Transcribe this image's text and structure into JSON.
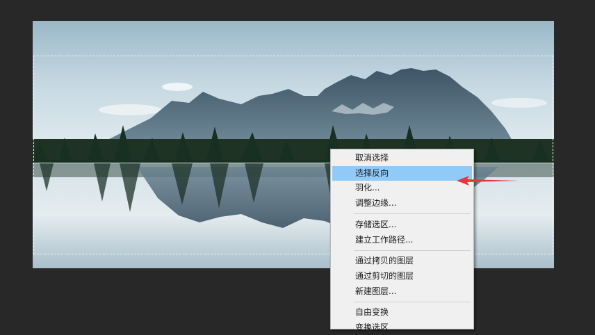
{
  "context_menu": {
    "groups": [
      [
        {
          "label": "取消选择",
          "highlighted": false
        },
        {
          "label": "选择反向",
          "highlighted": true
        },
        {
          "label": "羽化...",
          "highlighted": false
        },
        {
          "label": "调整边缘...",
          "highlighted": false
        }
      ],
      [
        {
          "label": "存储选区...",
          "highlighted": false
        },
        {
          "label": "建立工作路径...",
          "highlighted": false
        }
      ],
      [
        {
          "label": "通过拷贝的图层",
          "highlighted": false
        },
        {
          "label": "通过剪切的图层",
          "highlighted": false
        },
        {
          "label": "新建图层...",
          "highlighted": false
        }
      ],
      [
        {
          "label": "自由变换",
          "highlighted": false
        },
        {
          "label": "变换选区",
          "highlighted": false
        }
      ]
    ]
  },
  "annotation": {
    "icon": "red-arrow-icon",
    "color": "#e8363a"
  },
  "colors": {
    "highlight": "#91c9f7",
    "canvas_background": "#282828"
  }
}
